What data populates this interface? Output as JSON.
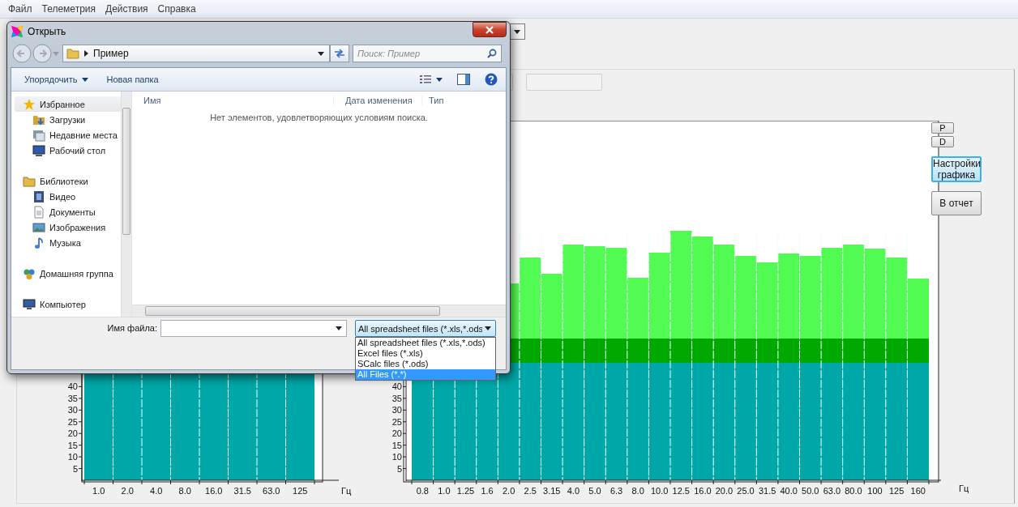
{
  "menu": [
    "Файл",
    "Телеметрия",
    "Действия",
    "Справка"
  ],
  "side_buttons": [
    {
      "label": "P",
      "kind": "small",
      "highlighted": false
    },
    {
      "label": "D",
      "kind": "small",
      "highlighted": false
    },
    {
      "label": "Настройки графика",
      "kind": "wide",
      "highlighted": true
    },
    {
      "label": "В отчет",
      "kind": "wide",
      "highlighted": false
    }
  ],
  "charts": [
    {
      "y_labels": [
        "40",
        "35",
        "30",
        "25",
        "20",
        "15",
        "10",
        "5"
      ],
      "x_labels": [
        "1.0",
        "2.0",
        "4.0",
        "8.0",
        "16.0",
        "31.5",
        "63.0",
        "125"
      ],
      "unit": "Гц"
    },
    {
      "y_labels": [
        "40",
        "35",
        "30",
        "25",
        "20",
        "15",
        "10",
        "5"
      ],
      "x_labels": [
        "0.8",
        "1.0",
        "1.25",
        "1.6",
        "2.0",
        "2.5",
        "3.15",
        "4.0",
        "5.0",
        "6.3",
        "8.0",
        "10.0",
        "12.5",
        "16.0",
        "20.0",
        "25.0",
        "31.5",
        "40.0",
        "50.0",
        "63.0",
        "80.0",
        "100",
        "125",
        "160"
      ],
      "unit": "Гц"
    }
  ],
  "dialog": {
    "title": "Открыть",
    "path": "Пример",
    "search": {
      "placeholder": "Поиск: Пример"
    },
    "toolbar": [
      {
        "label": "Упорядочить",
        "kind": "menu"
      },
      {
        "label": "Новая папка",
        "kind": "plain"
      }
    ],
    "nav": [
      {
        "label": "Избранное",
        "kind": "star",
        "selected": true,
        "children": [
          {
            "label": "Загрузки",
            "kind": "download",
            "selected": false
          },
          {
            "label": "Недавние места",
            "kind": "recent",
            "selected": false
          },
          {
            "label": "Рабочий стол",
            "kind": "desktop",
            "selected": false
          }
        ]
      },
      {
        "label": "Библиотеки",
        "kind": "library",
        "selected": false,
        "children": [
          {
            "label": "Видео",
            "kind": "video",
            "selected": false
          },
          {
            "label": "Документы",
            "kind": "document",
            "selected": false
          },
          {
            "label": "Изображения",
            "kind": "image",
            "selected": false
          },
          {
            "label": "Музыка",
            "kind": "music",
            "selected": false
          }
        ]
      },
      {
        "label": "Домашняя группа",
        "kind": "homegroup",
        "selected": false
      },
      {
        "label": "Компьютер",
        "kind": "computer",
        "selected": false
      }
    ],
    "columns": [
      "Имя",
      "Дата изменения",
      "Тип"
    ],
    "empty_message": "Нет элементов, удовлетворяющих условиям поиска.",
    "file_name": {
      "label": "Имя файла:"
    },
    "filter": {
      "value": "All spreadsheet files (*.xls,*.ods",
      "expanded": true,
      "options": [
        {
          "label": "All spreadsheet files (*.xls,*.ods)",
          "selected": false
        },
        {
          "label": "Excel files (*.xls)",
          "selected": false
        },
        {
          "label": "SCalc files (*.ods)",
          "selected": false
        },
        {
          "label": "All Files (*.*)",
          "selected": true
        }
      ]
    }
  }
}
